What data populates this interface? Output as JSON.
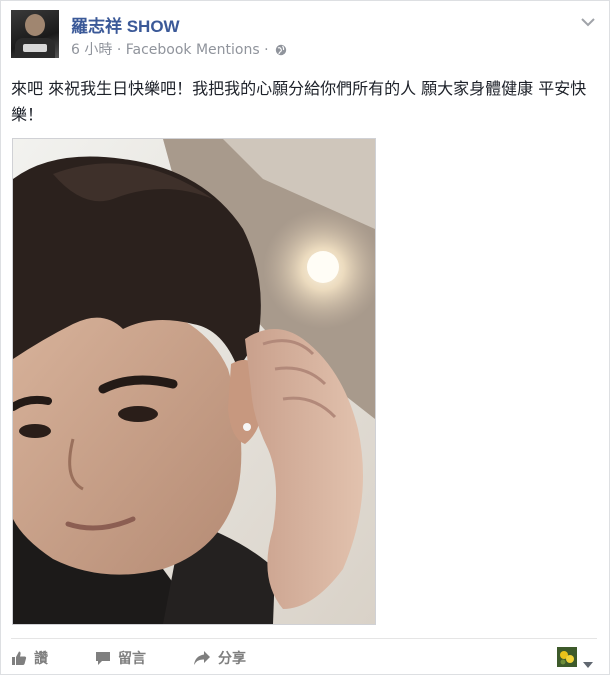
{
  "post": {
    "author": "羅志祥 SHOW",
    "time": "6 小時",
    "separator": "·",
    "source": "Facebook Mentions",
    "text": "來吧 來祝我生日快樂吧！我把我的心願分給你們所有的人 願大家身體健康 平安快樂！"
  },
  "actions": {
    "like_label": "讚",
    "comment_label": "留言",
    "share_label": "分享"
  },
  "icons": {
    "chevron": "chevron-down-icon",
    "globe": "globe-icon",
    "like": "thumbs-up-icon",
    "comment": "speech-bubble-icon",
    "share": "share-arrow-icon",
    "caret": "caret-down-icon"
  },
  "colors": {
    "author": "#3b5998",
    "meta": "#90949c",
    "text": "#1d2129",
    "action": "#7f7f7f"
  }
}
